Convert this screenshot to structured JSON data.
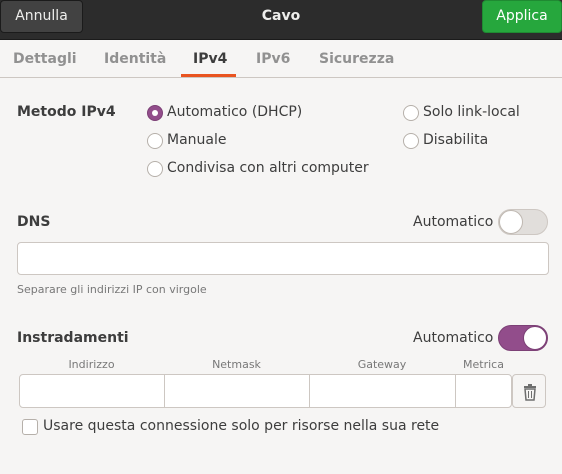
{
  "header": {
    "cancel_label": "Annulla",
    "title": "Cavo",
    "apply_label": "Applica"
  },
  "tabs": [
    {
      "label": "Dettagli",
      "active": false
    },
    {
      "label": "Identità",
      "active": false
    },
    {
      "label": "IPv4",
      "active": true
    },
    {
      "label": "IPv6",
      "active": false
    },
    {
      "label": "Sicurezza",
      "active": false
    }
  ],
  "method": {
    "label": "Metodo IPv4",
    "options": [
      {
        "label": "Automatico (DHCP)",
        "checked": true
      },
      {
        "label": "Manuale",
        "checked": false
      },
      {
        "label": "Condivisa con altri computer",
        "checked": false
      },
      {
        "label": "Solo link-local",
        "checked": false
      },
      {
        "label": "Disabilita",
        "checked": false
      }
    ]
  },
  "dns": {
    "label": "DNS",
    "auto_label": "Automatico",
    "auto_on": false,
    "value": "",
    "hint": "Separare gli indirizzi IP con virgole"
  },
  "routes": {
    "label": "Instradamenti",
    "auto_label": "Automatico",
    "auto_on": true,
    "columns": [
      "Indirizzo",
      "Netmask",
      "Gateway",
      "Metrica"
    ]
  },
  "only_local": {
    "label": "Usare questa connessione solo per risorse nella sua rete",
    "checked": false
  },
  "colors": {
    "accent": "#924d8b",
    "apply": "#26a73d",
    "tab_underline": "#e95420",
    "header_bg": "#2c2c2c"
  }
}
